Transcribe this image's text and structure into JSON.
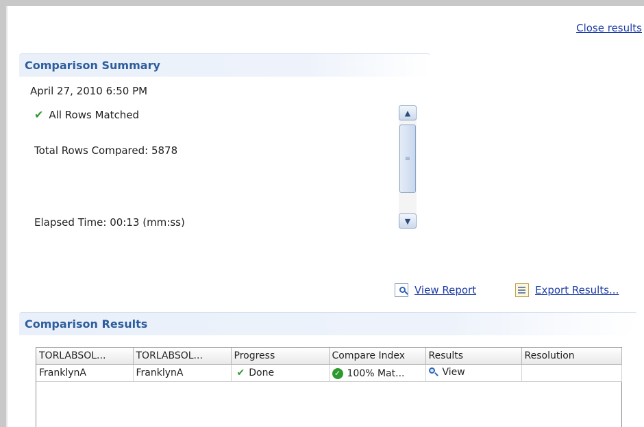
{
  "header": {
    "close_results": "Close results"
  },
  "summary": {
    "title": "Comparison Summary",
    "date": "April 27, 2010 6:50 PM",
    "status": "All Rows Matched",
    "total_rows": "Total Rows Compared: 5878",
    "elapsed": "Elapsed Time: 00:13 (mm:ss)"
  },
  "actions": {
    "view_report": "View Report",
    "export_results": "Export Results..."
  },
  "results": {
    "title": "Comparison Results",
    "columns": [
      "TORLABSOL...",
      "TORLABSOL...",
      "Progress",
      "Compare Index",
      "Results",
      "Resolution"
    ],
    "rows": [
      {
        "col1": "FranklynA",
        "col2": "FranklynA",
        "progress": "Done",
        "compare_index": "100% Mat...",
        "results": "View",
        "resolution": ""
      }
    ]
  },
  "colors": {
    "accent": "#2d5d9c",
    "link": "#1f3da6",
    "success": "#2e9a2e"
  }
}
